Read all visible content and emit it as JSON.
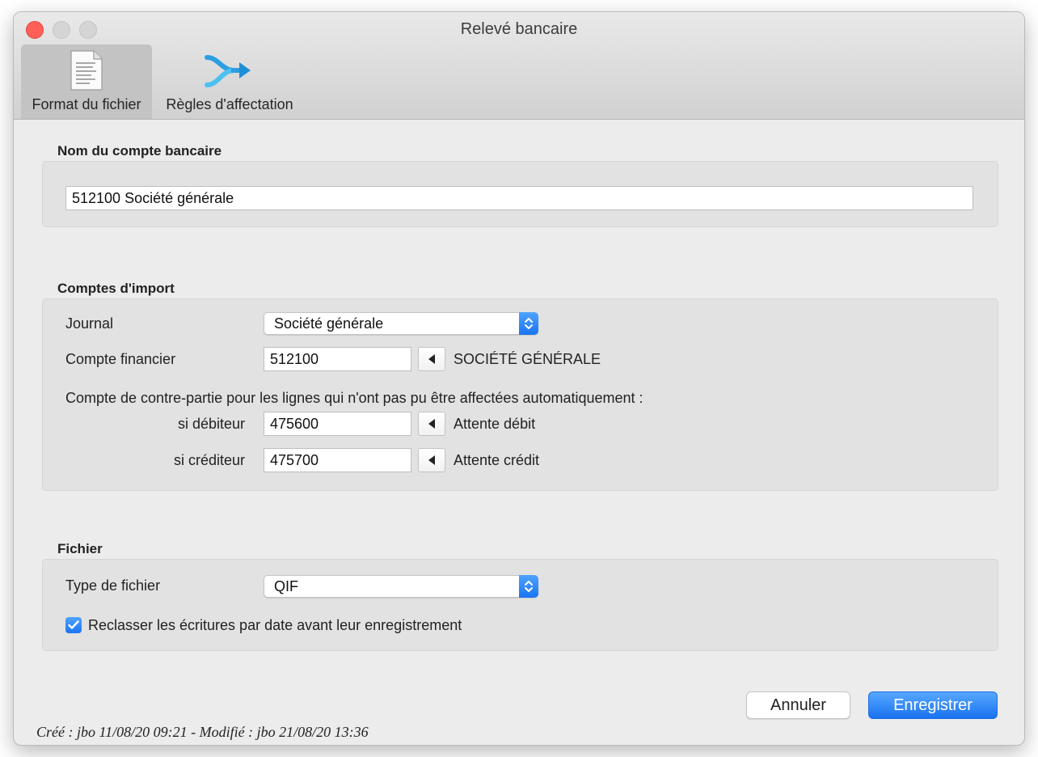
{
  "window": {
    "title": "Relevé bancaire"
  },
  "toolbar": {
    "file_format_label": "Format du fichier",
    "rules_label": "Règles d'affectation"
  },
  "bank_account": {
    "section_title": "Nom du compte bancaire",
    "name_value": "512100 Société générale"
  },
  "import_accounts": {
    "section_title": "Comptes d'import",
    "journal_label": "Journal",
    "journal_value": "Société générale",
    "financial_label": "Compte financier",
    "financial_value": "512100",
    "financial_name": "SOCIÉTÉ GÉNÉRALE",
    "counterpart_text": "Compte de contre-partie pour les lignes qui n'ont pas pu être affectées automatiquement :",
    "debit_label": "si débiteur",
    "debit_value": "475600",
    "debit_name": "Attente débit",
    "credit_label": "si créditeur",
    "credit_value": "475700",
    "credit_name": "Attente crédit"
  },
  "file": {
    "section_title": "Fichier",
    "type_label": "Type de fichier",
    "type_value": "QIF",
    "reorder_label": "Reclasser les écritures par date avant leur enregistrement",
    "reorder_checked": true
  },
  "buttons": {
    "cancel": "Annuler",
    "save": "Enregistrer"
  },
  "footer": {
    "meta": "Créé : jbo 11/08/20 09:21 - Modifié : jbo 21/08/20 13:36"
  },
  "colors": {
    "accent": "#1a74f2",
    "close": "#ff5f57"
  },
  "icons": {
    "file_format": "document-icon",
    "rules": "arrows-merge-icon",
    "popup": "chevron-updown-icon",
    "lookup": "triangle-left-icon",
    "check": "checkmark-icon"
  }
}
